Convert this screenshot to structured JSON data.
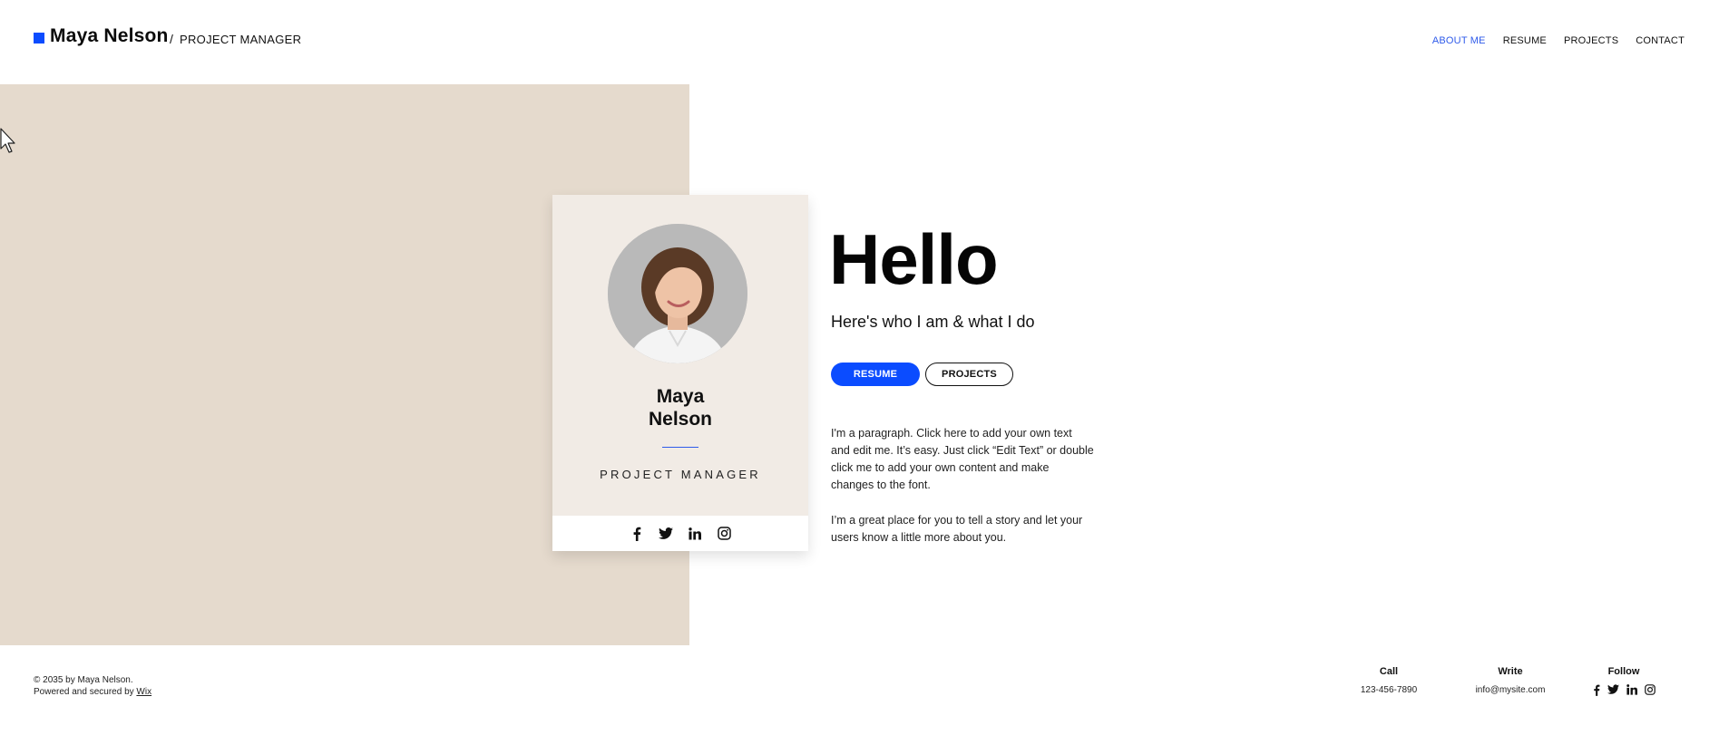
{
  "header": {
    "name": "Maya Nelson",
    "separator": "/",
    "role": "PROJECT MANAGER",
    "nav": [
      {
        "label": "ABOUT ME",
        "active": true
      },
      {
        "label": "RESUME",
        "active": false
      },
      {
        "label": "PROJECTS",
        "active": false
      },
      {
        "label": "CONTACT",
        "active": false
      }
    ]
  },
  "card": {
    "first_name": "Maya",
    "last_name": "Nelson",
    "role": "PROJECT MANAGER",
    "social_icons": [
      "facebook-icon",
      "twitter-icon",
      "linkedin-icon",
      "instagram-icon"
    ]
  },
  "hero": {
    "title": "Hello",
    "subtitle": "Here's who I am & what I do",
    "buttons": {
      "resume": "RESUME",
      "projects": "PROJECTS"
    },
    "paragraph1": "I'm a paragraph. Click here to add your own text and edit me. It’s easy. Just click “Edit Text” or double click me to add your own content and make changes to the font.",
    "paragraph2": "I’m a great place for you to tell a story and let your users know a little more about you."
  },
  "footer": {
    "copyright": "© 2035 by Maya Nelson.",
    "powered": "Powered and secured by",
    "wix": "Wix",
    "call": {
      "heading": "Call",
      "value": "123-456-7890"
    },
    "write": {
      "heading": "Write",
      "value": "info@mysite.com"
    },
    "follow": {
      "heading": "Follow"
    }
  },
  "colors": {
    "accent": "#0b4cff",
    "nav_active": "#2f5bea",
    "beige": "#e5dacd",
    "card_bg": "#f1ebe5"
  }
}
